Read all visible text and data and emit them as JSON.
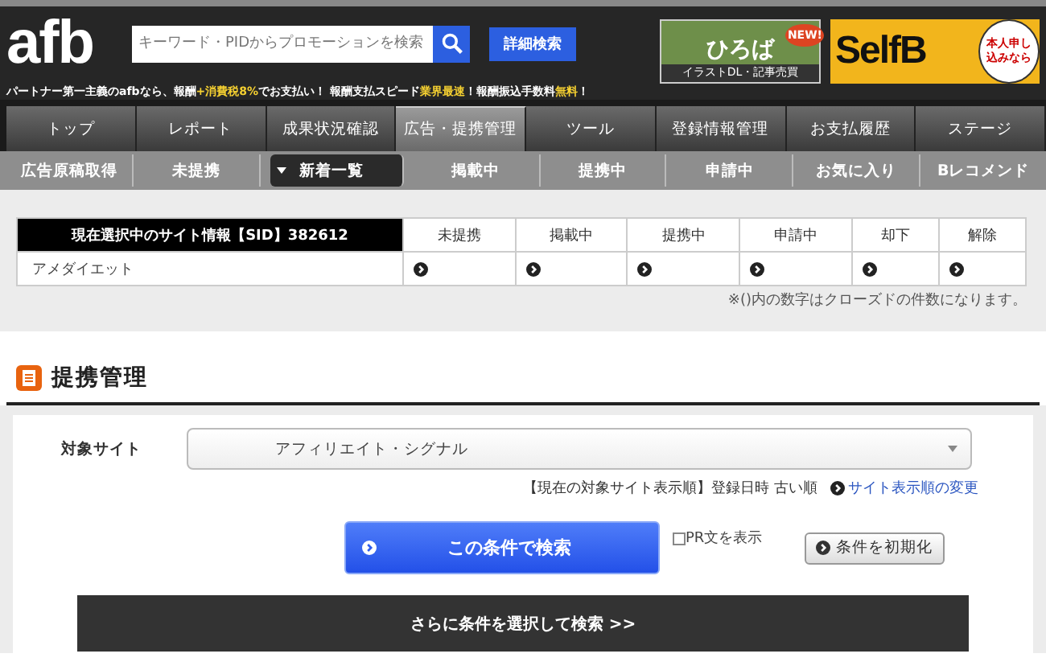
{
  "header": {
    "logo": "afb",
    "search": {
      "placeholder": "キーワード・PIDからプロモーションを検索"
    },
    "detail_search_button": "詳細検索",
    "tagline": [
      {
        "text": "パートナー第一主義のafbなら、報酬",
        "highlight": false
      },
      {
        "text": "+消費税8%",
        "highlight": true
      },
      {
        "text": "でお支払い！ 報酬支払スピード",
        "highlight": false
      },
      {
        "text": "業界最速",
        "highlight": true
      },
      {
        "text": "！報酬振込手数料",
        "highlight": false
      },
      {
        "text": "無料",
        "highlight": true
      },
      {
        "text": "！",
        "highlight": false
      }
    ],
    "banners": [
      {
        "kind": "hiroba",
        "title": "ひろば",
        "caption": "イラストDL・記事売買",
        "badge": "NEW!"
      },
      {
        "kind": "selfb",
        "title": "SelfB",
        "bubble": "本人申し込みなら"
      }
    ]
  },
  "main_nav": [
    {
      "label": "トップ",
      "selected": false
    },
    {
      "label": "レポート",
      "selected": false
    },
    {
      "label": "成果状況確認",
      "selected": false
    },
    {
      "label": "広告・提携管理",
      "selected": true
    },
    {
      "label": "ツール",
      "selected": false
    },
    {
      "label": "登録情報管理",
      "selected": false
    },
    {
      "label": "お支払履歴",
      "selected": false
    },
    {
      "label": "ステージ",
      "selected": false
    }
  ],
  "sub_nav": [
    {
      "label": "広告原稿取得",
      "selected": false
    },
    {
      "label": "未提携",
      "selected": false
    },
    {
      "label": "新着一覧",
      "selected": true
    },
    {
      "label": "掲載中",
      "selected": false
    },
    {
      "label": "提携中",
      "selected": false
    },
    {
      "label": "申請中",
      "selected": false
    },
    {
      "label": "お気に入り",
      "selected": false
    },
    {
      "label": "Bレコメンド",
      "selected": false
    }
  ],
  "site_table": {
    "title": "現在選択中のサイト情報【SID】382612",
    "columns": [
      "未提携",
      "掲載中",
      "提携中",
      "申請中",
      "却下",
      "解除"
    ],
    "rows": [
      {
        "site": "アメダイエット"
      }
    ],
    "note": "※()内の数字はクローズドの件数になります。"
  },
  "section": {
    "title": "提携管理"
  },
  "form": {
    "target_label": "対象サイト",
    "target_value": "アフィリエイト・シグナル",
    "sort_info": "【現在の対象サイト表示順】登録日時 古い順",
    "sort_link": "サイト表示順の変更",
    "search_button": "この条件で検索",
    "pr_checkbox": {
      "label": "PR文を表示",
      "checked": false
    },
    "reset_button": "条件を初期化",
    "more_conditions": "さらに条件を選択して検索 >>"
  }
}
